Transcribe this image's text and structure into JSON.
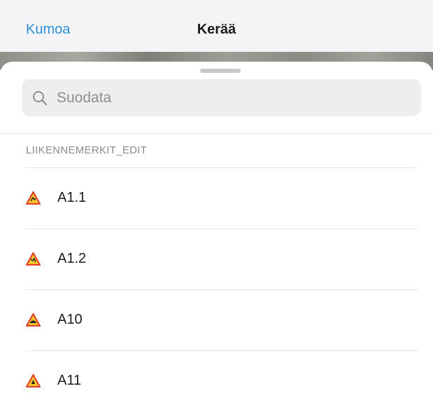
{
  "nav": {
    "cancel_label": "Kumoa",
    "title": "Kerää"
  },
  "search": {
    "placeholder": "Suodata",
    "value": "",
    "icon": "search-icon"
  },
  "section": {
    "header": "LIIKENNEMERKIT_EDIT"
  },
  "items": [
    {
      "label": "A1.1",
      "icon": "warning-sign-icon"
    },
    {
      "label": "A1.2",
      "icon": "warning-sign-icon"
    },
    {
      "label": "A10",
      "icon": "warning-sign-icon"
    },
    {
      "label": "A11",
      "icon": "warning-sign-icon"
    }
  ],
  "colors": {
    "accent": "#2d8fd5",
    "sign_fill": "#f7c62f",
    "sign_border": "#e23a26"
  }
}
